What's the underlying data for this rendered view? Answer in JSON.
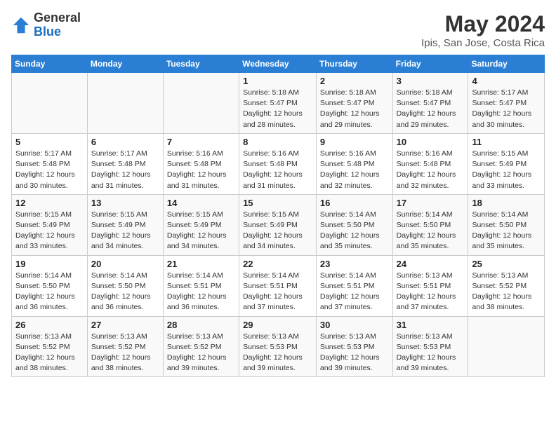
{
  "header": {
    "logo": {
      "general": "General",
      "blue": "Blue"
    },
    "title": "May 2024",
    "subtitle": "Ipis, San Jose, Costa Rica"
  },
  "calendar": {
    "weekdays": [
      "Sunday",
      "Monday",
      "Tuesday",
      "Wednesday",
      "Thursday",
      "Friday",
      "Saturday"
    ],
    "weeks": [
      [
        {
          "day": "",
          "info": ""
        },
        {
          "day": "",
          "info": ""
        },
        {
          "day": "",
          "info": ""
        },
        {
          "day": "1",
          "info": "Sunrise: 5:18 AM\nSunset: 5:47 PM\nDaylight: 12 hours\nand 28 minutes."
        },
        {
          "day": "2",
          "info": "Sunrise: 5:18 AM\nSunset: 5:47 PM\nDaylight: 12 hours\nand 29 minutes."
        },
        {
          "day": "3",
          "info": "Sunrise: 5:18 AM\nSunset: 5:47 PM\nDaylight: 12 hours\nand 29 minutes."
        },
        {
          "day": "4",
          "info": "Sunrise: 5:17 AM\nSunset: 5:47 PM\nDaylight: 12 hours\nand 30 minutes."
        }
      ],
      [
        {
          "day": "5",
          "info": "Sunrise: 5:17 AM\nSunset: 5:48 PM\nDaylight: 12 hours\nand 30 minutes."
        },
        {
          "day": "6",
          "info": "Sunrise: 5:17 AM\nSunset: 5:48 PM\nDaylight: 12 hours\nand 31 minutes."
        },
        {
          "day": "7",
          "info": "Sunrise: 5:16 AM\nSunset: 5:48 PM\nDaylight: 12 hours\nand 31 minutes."
        },
        {
          "day": "8",
          "info": "Sunrise: 5:16 AM\nSunset: 5:48 PM\nDaylight: 12 hours\nand 31 minutes."
        },
        {
          "day": "9",
          "info": "Sunrise: 5:16 AM\nSunset: 5:48 PM\nDaylight: 12 hours\nand 32 minutes."
        },
        {
          "day": "10",
          "info": "Sunrise: 5:16 AM\nSunset: 5:48 PM\nDaylight: 12 hours\nand 32 minutes."
        },
        {
          "day": "11",
          "info": "Sunrise: 5:15 AM\nSunset: 5:49 PM\nDaylight: 12 hours\nand 33 minutes."
        }
      ],
      [
        {
          "day": "12",
          "info": "Sunrise: 5:15 AM\nSunset: 5:49 PM\nDaylight: 12 hours\nand 33 minutes."
        },
        {
          "day": "13",
          "info": "Sunrise: 5:15 AM\nSunset: 5:49 PM\nDaylight: 12 hours\nand 34 minutes."
        },
        {
          "day": "14",
          "info": "Sunrise: 5:15 AM\nSunset: 5:49 PM\nDaylight: 12 hours\nand 34 minutes."
        },
        {
          "day": "15",
          "info": "Sunrise: 5:15 AM\nSunset: 5:49 PM\nDaylight: 12 hours\nand 34 minutes."
        },
        {
          "day": "16",
          "info": "Sunrise: 5:14 AM\nSunset: 5:50 PM\nDaylight: 12 hours\nand 35 minutes."
        },
        {
          "day": "17",
          "info": "Sunrise: 5:14 AM\nSunset: 5:50 PM\nDaylight: 12 hours\nand 35 minutes."
        },
        {
          "day": "18",
          "info": "Sunrise: 5:14 AM\nSunset: 5:50 PM\nDaylight: 12 hours\nand 35 minutes."
        }
      ],
      [
        {
          "day": "19",
          "info": "Sunrise: 5:14 AM\nSunset: 5:50 PM\nDaylight: 12 hours\nand 36 minutes."
        },
        {
          "day": "20",
          "info": "Sunrise: 5:14 AM\nSunset: 5:50 PM\nDaylight: 12 hours\nand 36 minutes."
        },
        {
          "day": "21",
          "info": "Sunrise: 5:14 AM\nSunset: 5:51 PM\nDaylight: 12 hours\nand 36 minutes."
        },
        {
          "day": "22",
          "info": "Sunrise: 5:14 AM\nSunset: 5:51 PM\nDaylight: 12 hours\nand 37 minutes."
        },
        {
          "day": "23",
          "info": "Sunrise: 5:14 AM\nSunset: 5:51 PM\nDaylight: 12 hours\nand 37 minutes."
        },
        {
          "day": "24",
          "info": "Sunrise: 5:13 AM\nSunset: 5:51 PM\nDaylight: 12 hours\nand 37 minutes."
        },
        {
          "day": "25",
          "info": "Sunrise: 5:13 AM\nSunset: 5:52 PM\nDaylight: 12 hours\nand 38 minutes."
        }
      ],
      [
        {
          "day": "26",
          "info": "Sunrise: 5:13 AM\nSunset: 5:52 PM\nDaylight: 12 hours\nand 38 minutes."
        },
        {
          "day": "27",
          "info": "Sunrise: 5:13 AM\nSunset: 5:52 PM\nDaylight: 12 hours\nand 38 minutes."
        },
        {
          "day": "28",
          "info": "Sunrise: 5:13 AM\nSunset: 5:52 PM\nDaylight: 12 hours\nand 39 minutes."
        },
        {
          "day": "29",
          "info": "Sunrise: 5:13 AM\nSunset: 5:53 PM\nDaylight: 12 hours\nand 39 minutes."
        },
        {
          "day": "30",
          "info": "Sunrise: 5:13 AM\nSunset: 5:53 PM\nDaylight: 12 hours\nand 39 minutes."
        },
        {
          "day": "31",
          "info": "Sunrise: 5:13 AM\nSunset: 5:53 PM\nDaylight: 12 hours\nand 39 minutes."
        },
        {
          "day": "",
          "info": ""
        }
      ]
    ]
  }
}
